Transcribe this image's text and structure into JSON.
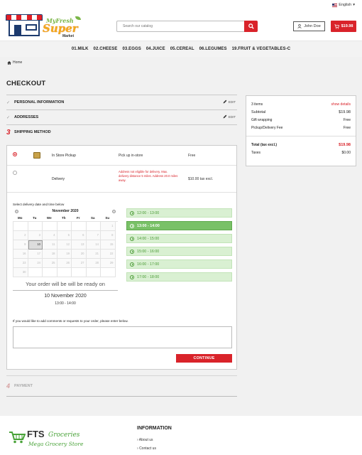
{
  "topbar": {
    "language": "English"
  },
  "header": {
    "logo": {
      "line1": "MyFresh",
      "line2": "Super",
      "line3": "Market"
    },
    "search_placeholder": "Search our catalog",
    "user_name": "John Doe",
    "cart_total": "$19.98"
  },
  "categories": [
    "01.MILK",
    "02.CHEESE",
    "03.EGGS",
    "04.JUICE",
    "05.CEREAL",
    "06.LEGUMES",
    "19.FRUIT & VEGETABLES-C"
  ],
  "breadcrumb": {
    "home": "Home"
  },
  "checkout": {
    "title": "CHECKOUT",
    "steps": {
      "personal": "PERSONAL INFORMATION",
      "addresses": "ADDRESSES",
      "shipping_number": "3",
      "shipping": "SHIPPING METHOD",
      "payment_number": "4",
      "payment": "PAYMENT",
      "edit_label": "EDIT"
    },
    "carriers": [
      {
        "name": "In Store Pickup",
        "delay": "Pick up in-store",
        "price": "Free",
        "selected": true
      },
      {
        "name": "Delivery",
        "warning": "Address not eligible for delivery. Max. delivery distance 5 miles. Address 20.0 miles away.",
        "price": "$10.00 tax excl.",
        "selected": false
      }
    ],
    "select_label": "Select delivery date and time below",
    "calendar": {
      "month": "November 2020",
      "weekdays": [
        "Mo",
        "Tu",
        "We",
        "Th",
        "Fr",
        "Sa",
        "Su"
      ],
      "weeks": [
        [
          "",
          "",
          "",
          "",
          "",
          "",
          "1"
        ],
        [
          "2",
          "3",
          "4",
          "5",
          "6",
          "7",
          "8"
        ],
        [
          "9",
          "10",
          "11",
          "12",
          "13",
          "14",
          "15"
        ],
        [
          "16",
          "17",
          "18",
          "19",
          "20",
          "21",
          "22"
        ],
        [
          "23",
          "24",
          "25",
          "26",
          "27",
          "28",
          "29"
        ],
        [
          "30",
          "",
          "",
          "",
          "",
          "",
          ""
        ]
      ],
      "selected_day": "10"
    },
    "time_slots": [
      {
        "label": "12:00 - 13:00",
        "active": false
      },
      {
        "label": "13:00 - 14:00",
        "active": true
      },
      {
        "label": "14:00 - 15:00",
        "active": false
      },
      {
        "label": "15:00 - 16:00",
        "active": false
      },
      {
        "label": "16:00 - 17:00",
        "active": false
      },
      {
        "label": "17:00 - 18:00",
        "active": false
      }
    ],
    "ready_text": "Your order will be will be ready on",
    "ready_date": "10 November 2020",
    "ready_time": "13:00 - 14:00",
    "comments_label": "If you would like to add comments or requests to your order, please enter below.",
    "continue_label": "CONTINUE"
  },
  "summary": {
    "items": "3 items",
    "show_details": "show details",
    "subtotal_label": "Subtotal",
    "subtotal": "$19.98",
    "gift_label": "Gift wrapping",
    "gift": "Free",
    "pickup_label": "Pickup/Delivery Fee",
    "pickup": "Free",
    "total_label": "Total (tax excl.)",
    "total": "$19.98",
    "taxes_label": "Taxes",
    "taxes": "$0.00"
  },
  "footer": {
    "logo": {
      "fts": "FTS",
      "groceries": "Groceries",
      "tagline": "Mega Grocery Store"
    },
    "info_title": "INFORMATION",
    "links": [
      "About us",
      "Contact us"
    ]
  },
  "colors": {
    "accent": "#d9232a",
    "slot": "#d9f0d2",
    "slot_active": "#79c167"
  }
}
